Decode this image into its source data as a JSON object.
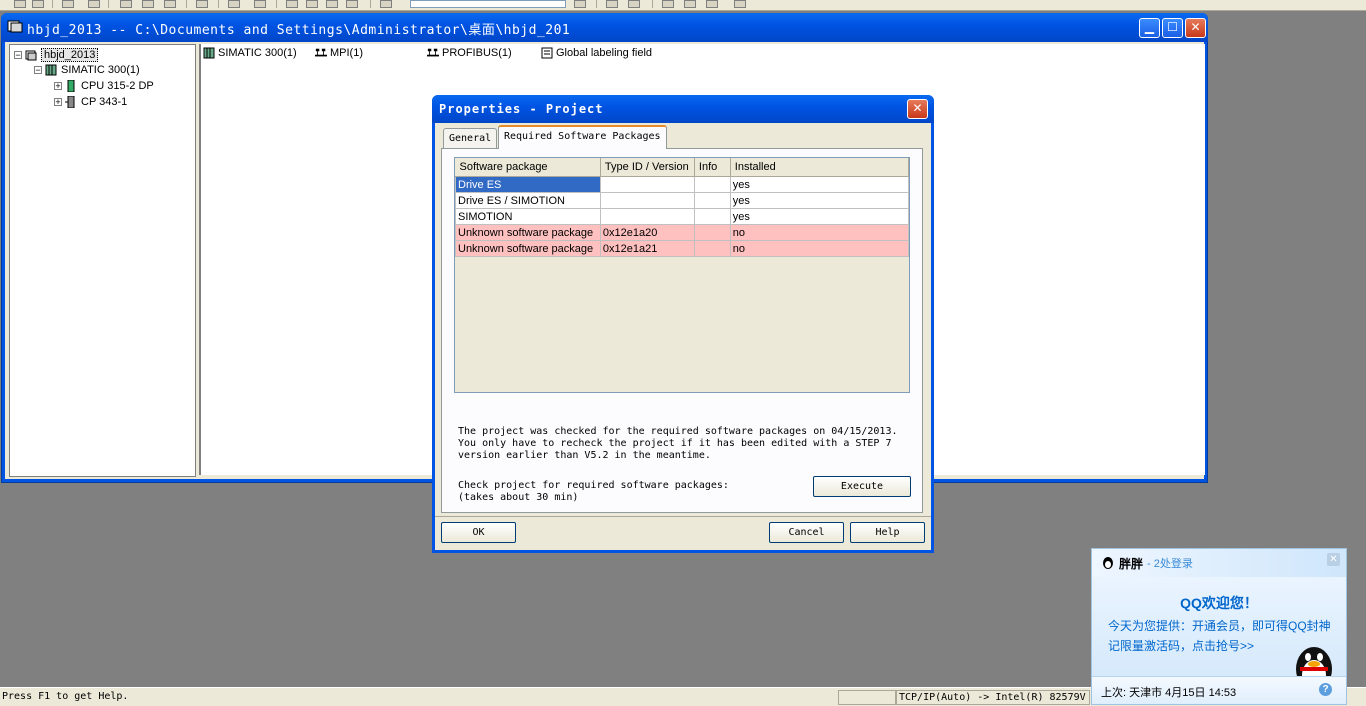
{
  "project_window": {
    "title": "hbjd_2013 -- C:\\Documents and Settings\\Administrator\\桌面\\hbjd_201",
    "tree": [
      {
        "label": "hbjd_2013",
        "expander": "−"
      },
      {
        "label": "SIMATIC 300(1)",
        "expander": "−"
      },
      {
        "label": "CPU 315-2 DP",
        "expander": "+"
      },
      {
        "label": "CP 343-1",
        "expander": "+"
      }
    ],
    "objects": [
      {
        "label": "SIMATIC 300(1)"
      },
      {
        "label": "MPI(1)"
      },
      {
        "label": "PROFIBUS(1)"
      },
      {
        "label": "Global labeling field"
      }
    ]
  },
  "dialog": {
    "title": "Properties - Project",
    "tabs": [
      {
        "label": "General"
      },
      {
        "label": "Required Software Packages"
      }
    ],
    "table": {
      "headers": [
        "Software package",
        "Type ID / Version",
        "Info",
        "Installed"
      ],
      "rows": [
        {
          "package": "Drive ES",
          "type": "",
          "info": "",
          "installed": "yes"
        },
        {
          "package": "Drive ES / SIMOTION",
          "type": "",
          "info": "",
          "installed": "yes"
        },
        {
          "package": "SIMOTION",
          "type": "",
          "info": "",
          "installed": "yes"
        },
        {
          "package": "Unknown software package",
          "type": "0x12e1a20",
          "info": "",
          "installed": "no"
        },
        {
          "package": "Unknown software package",
          "type": "0x12e1a21",
          "info": "",
          "installed": "no"
        }
      ]
    },
    "message": "The project was checked for the required software packages on 04/15/2013.\nYou only have to recheck the project if it has been edited with a STEP 7\nversion earlier than V5.2 in the meantime.",
    "check_message": "Check project for required software packages:\n(takes about 30 min)",
    "execute_label": "Execute",
    "ok_label": "OK",
    "cancel_label": "Cancel",
    "help_label": "Help"
  },
  "statusbar": {
    "help_text": "Press F1 to get Help.",
    "interface": "TCP/IP(Auto) -> Intel(R) 82579V"
  },
  "qq_popup": {
    "user": "胖胖",
    "login_note": "- 2处登录",
    "welcome": "QQ欢迎您！",
    "line1": "今天为您提供：开通会员，即可得QQ封神",
    "line2": "记限量激活码，点击抢号>>",
    "last_login": "上次: 天津市  4月15日 14:53"
  },
  "colors": {
    "xp_blue": "#0054e3",
    "selection": "#316ac5",
    "unknown_row": "#ffc0c0",
    "tab_highlight": "#e68b2c",
    "qq_blue": "#0066cc"
  }
}
